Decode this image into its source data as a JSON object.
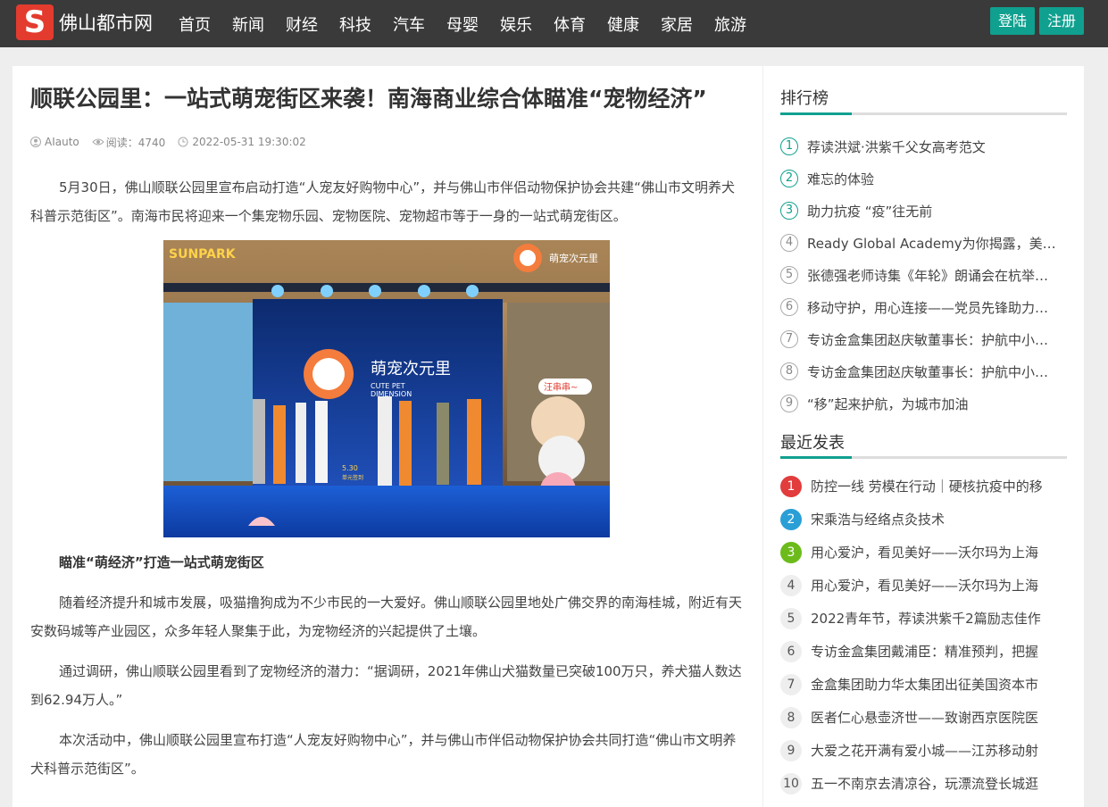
{
  "header": {
    "logo_text": "佛山都市网",
    "logo_letter": "S",
    "nav": [
      "首页",
      "新闻",
      "财经",
      "科技",
      "汽车",
      "母婴",
      "娱乐",
      "体育",
      "健康",
      "家居",
      "旅游"
    ],
    "login_label": "登陆",
    "register_label": "注册"
  },
  "article": {
    "title": "顺联公园里：一站式萌宠街区来袭！南海商业综合体瞄准“宠物经济”",
    "author": "AIauto",
    "reads": "阅读：4740",
    "date": "2022-05-31 19:30:02",
    "para1": "5月30日，佛山顺联公园里宣布启动打造“人宠友好购物中心”，并与佛山市伴侣动物保护协会共建“佛山市文明养犬科普示范街区”。南海市民将迎来一个集宠物乐园、宠物医院、宠物超市等于一身的一站式萌宠街区。",
    "photo": {
      "corner_logo": "SUNPARK",
      "brand_cn": "萌宠次元里",
      "brand_en_1": "CUTE PET",
      "brand_en_2": "DIMENSION",
      "stage_date": "5.30",
      "stage_caption": "单元签到",
      "sign_text": "汪串串~"
    },
    "subhead": "瞄准“萌经济”打造一站式萌宠街区",
    "para2": "随着经济提升和城市发展，吸猫撸狗成为不少市民的一大爱好。佛山顺联公园里地处广佛交界的南海桂城，附近有天安数码城等产业园区，众多年轻人聚集于此，为宠物经济的兴起提供了土壤。",
    "para3": "通过调研，佛山顺联公园里看到了宠物经济的潜力：“据调研，2021年佛山犬猫数量已突破100万只，养犬猫人数达到62.94万人。”",
    "para4": "本次活动中，佛山顺联公园里宣布打造“人宠友好购物中心”，并与佛山市伴侣动物保护协会共同打造“佛山市文明养犬科普示范街区”。"
  },
  "sidebar": {
    "ranking_title": "排行榜",
    "ranking": [
      "荐读洪斌·洪紫千父女高考范文",
      "难忘的体验",
      "助力抗疫 “疫”往无前",
      "Ready Global Academy为你揭露，美…",
      "张德强老师诗集《年轮》朗诵会在杭举…",
      "移动守护，用心连接——党员先锋助力…",
      "专访金盒集团赵庆敏董事长：护航中小…",
      "专访金盒集团赵庆敏董事长：护航中小…",
      "“移”起来护航，为城市加油"
    ],
    "ranking_numbers": [
      "1",
      "2",
      "3",
      "4",
      "5",
      "6",
      "7",
      "8",
      "9"
    ],
    "recent_title": "最近发表",
    "recent": [
      "防控一线 劳模在行动｜硬核抗疫中的移",
      "宋乘浩与经络点灸技术",
      "用心爱沪，看见美好——沃尔玛为上海",
      "用心爱沪，看见美好——沃尔玛为上海",
      "2022青年节，荐读洪紫千2篇励志佳作",
      "专访金盒集团戴浦臣：精准预判，把握",
      "金盒集团助力华太集团出征美国资本市",
      "医者仁心悬壶济世——致谢西京医院医",
      "大爱之花开满有爱小城——江苏移动射",
      "五一不南京去清凉谷，玩漂流登长城逛"
    ],
    "recent_numbers": [
      "1",
      "2",
      "3",
      "4",
      "5",
      "6",
      "7",
      "8",
      "9",
      "10"
    ]
  },
  "colors": {
    "header_bg": "#3a3a3a",
    "accent_teal": "#10a08f",
    "logo_red": "#e33b2e",
    "rank1": "#e23c3c",
    "rank2": "#2a9fd6",
    "rank3": "#6cbb1b"
  },
  "icons": {
    "author": "user-icon",
    "reads": "eye-icon",
    "date": "clock-icon"
  }
}
